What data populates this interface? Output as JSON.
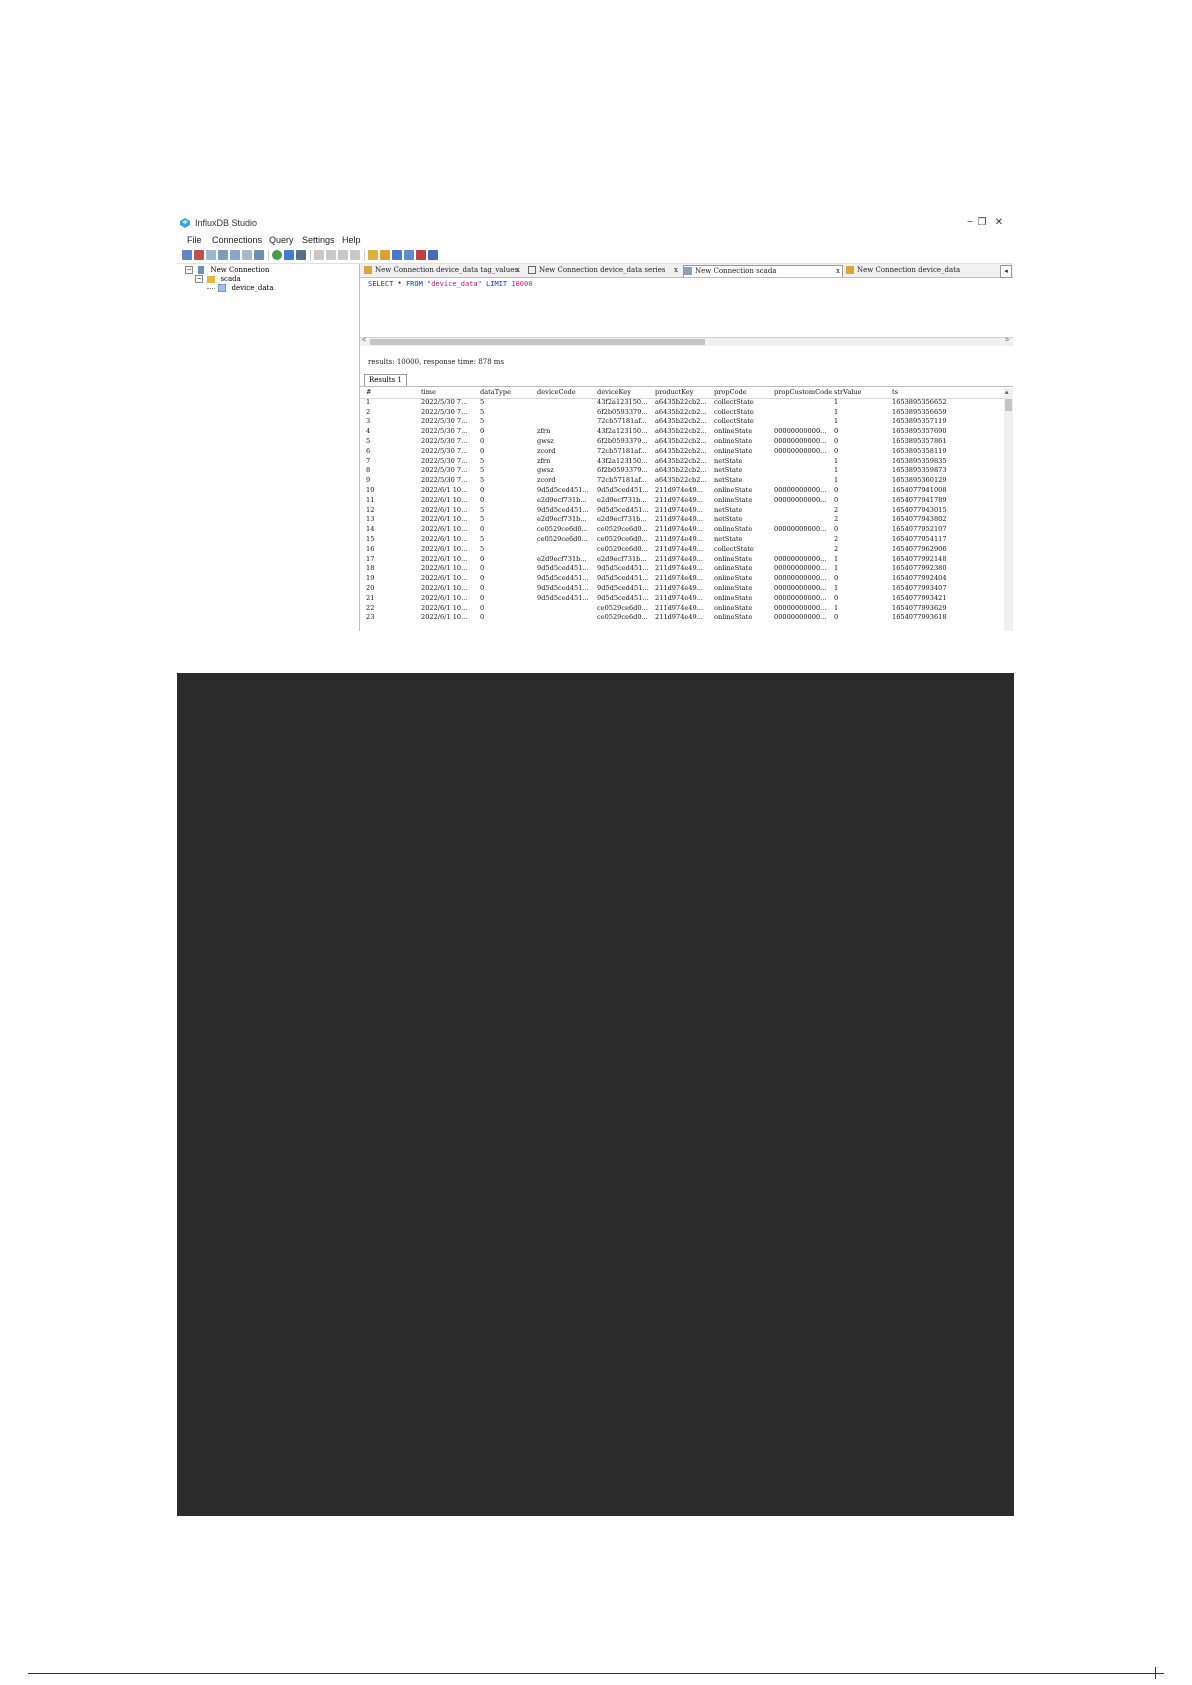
{
  "window": {
    "title": "InfluxDB Studio",
    "controls": {
      "minimize": "−",
      "restore": "❐",
      "close": "✕"
    }
  },
  "menu": [
    "File",
    "Connections",
    "Query",
    "Settings",
    "Help"
  ],
  "toolbar_icons": [
    "new-connection-icon",
    "delete-icon",
    "edit-icon",
    "database-icon",
    "chart-icon",
    "table-icon",
    "refresh-icon",
    "run-icon",
    "query-icon",
    "copy-icon",
    "paste-icon",
    "cut-icon",
    "undo-icon",
    "user-icon",
    "users-icon",
    "grid-icon",
    "list-icon",
    "export-icon",
    "settings-icon"
  ],
  "tree": {
    "connection": "New Connection",
    "database": "scada",
    "measurement": "device_data"
  },
  "tabs": [
    {
      "label": "New Connection device_data tag_values",
      "close": "x",
      "active": false
    },
    {
      "label": "New Connection device_data series",
      "close": "x",
      "active": false
    },
    {
      "label": "New Connection scada",
      "close": "x",
      "active": true
    },
    {
      "label": "New Connection device_data",
      "close": "",
      "active": false
    }
  ],
  "tab_scroll_arrow": "◂",
  "query": {
    "select": "SELECT",
    "star": " * ",
    "from": "FROM",
    "measurement": "\"device_data\"",
    "limit": "LIMIT",
    "limit_value": "10000"
  },
  "hscroll": {
    "left": "<",
    "right": ">"
  },
  "status": "results: 10000, response time: 878 ms",
  "result_tab": "Results 1",
  "grid": {
    "columns": [
      "#",
      "time",
      "dataType",
      "deviceCode",
      "deviceKey",
      "productKey",
      "propCode",
      "propCustomCode",
      "strValue",
      "ts"
    ],
    "rows": [
      [
        "1",
        "2022/5/30 7...",
        "5",
        "",
        "43f2a123150...",
        "a6435b22cb2...",
        "collectState",
        "",
        "1",
        "1653895356652"
      ],
      [
        "2",
        "2022/5/30 7...",
        "5",
        "",
        "6f2b0593379...",
        "a6435b22cb2...",
        "collectState",
        "",
        "1",
        "1653895356659"
      ],
      [
        "3",
        "2022/5/30 7...",
        "5",
        "",
        "72cb57181af...",
        "a6435b22cb2...",
        "collectState",
        "",
        "1",
        "1653895357119"
      ],
      [
        "4",
        "2022/5/30 7...",
        "0",
        "zfrn",
        "43f2a123150...",
        "a6435b22cb2...",
        "onlineState",
        "00000000000...",
        "0",
        "1653895357690"
      ],
      [
        "5",
        "2022/5/30 7...",
        "0",
        "gwsz",
        "6f2b0593379...",
        "a6435b22cb2...",
        "onlineState",
        "00000000000...",
        "0",
        "1653895357861"
      ],
      [
        "6",
        "2022/5/30 7...",
        "0",
        "zcord",
        "72cb57181af...",
        "a6435b22cb2...",
        "onlineState",
        "00000000000...",
        "0",
        "1653895358119"
      ],
      [
        "7",
        "2022/5/30 7...",
        "5",
        "zfrn",
        "43f2a123150...",
        "a6435b22cb2...",
        "netState",
        "",
        "1",
        "1653895359835"
      ],
      [
        "8",
        "2022/5/30 7...",
        "5",
        "gwsz",
        "6f2b0593379...",
        "a6435b22cb2...",
        "netState",
        "",
        "1",
        "1653895359873"
      ],
      [
        "9",
        "2022/5/30 7...",
        "5",
        "zcord",
        "72cb57181af...",
        "a6435b22cb2...",
        "netState",
        "",
        "1",
        "1653895360129"
      ],
      [
        "10",
        "2022/6/1 10...",
        "0",
        "9d5d5ced451...",
        "9d5d5ced451...",
        "211d974e49...",
        "onlineState",
        "00000000000...",
        "0",
        "1654077941008"
      ],
      [
        "11",
        "2022/6/1 10...",
        "0",
        "e2d9ecf731b...",
        "e2d9ecf731b...",
        "211d974e49...",
        "onlineState",
        "00000000000...",
        "0",
        "1654077941789"
      ],
      [
        "12",
        "2022/6/1 10...",
        "5",
        "9d5d5ced451...",
        "9d5d5ced451...",
        "211d974e49...",
        "netState",
        "",
        "2",
        "1654077943015"
      ],
      [
        "13",
        "2022/6/1 10...",
        "5",
        "e2d9ecf731b...",
        "e2d9ecf731b...",
        "211d974e49...",
        "netState",
        "",
        "2",
        "1654077943802"
      ],
      [
        "14",
        "2022/6/1 10...",
        "0",
        "ce0529ce6d0...",
        "ce0529ce6d0...",
        "211d974e49...",
        "onlineState",
        "00000000000...",
        "0",
        "1654077952107"
      ],
      [
        "15",
        "2022/6/1 10...",
        "5",
        "ce0529ce6d0...",
        "ce0529ce6d0...",
        "211d974e49...",
        "netState",
        "",
        "2",
        "1654077954117"
      ],
      [
        "16",
        "2022/6/1 10...",
        "5",
        "",
        "ce0529ce6d0...",
        "211d974e49...",
        "collectState",
        "",
        "2",
        "1654077962906"
      ],
      [
        "17",
        "2022/6/1 10...",
        "0",
        "e2d9ecf731b...",
        "e2d9ecf731b...",
        "211d974e49...",
        "onlineState",
        "00000000000...",
        "1",
        "1654077992148"
      ],
      [
        "18",
        "2022/6/1 10...",
        "0",
        "9d5d5ced451...",
        "9d5d5ced451...",
        "211d974e49...",
        "onlineState",
        "00000000000...",
        "1",
        "1654077992380"
      ],
      [
        "19",
        "2022/6/1 10...",
        "0",
        "9d5d5ced451...",
        "9d5d5ced451...",
        "211d974e49...",
        "onlineState",
        "00000000000...",
        "0",
        "1654077992404"
      ],
      [
        "20",
        "2022/6/1 10...",
        "0",
        "9d5d5ced451...",
        "9d5d5ced451...",
        "211d974e49...",
        "onlineState",
        "00000000000...",
        "1",
        "1654077993407"
      ],
      [
        "21",
        "2022/6/1 10...",
        "0",
        "9d5d5ced451...",
        "9d5d5ced451...",
        "211d974e49...",
        "onlineState",
        "00000000000...",
        "0",
        "1654077993421"
      ],
      [
        "22",
        "2022/6/1 10...",
        "0",
        "",
        "ce0529ce6d0...",
        "211d974e49...",
        "onlineState",
        "00000000000...",
        "1",
        "1654077993629"
      ],
      [
        "23",
        "2022/6/1 10...",
        "0",
        "",
        "ce0529ce6d0...",
        "211d974e49...",
        "onlineState",
        "00000000000...",
        "0",
        "1654077993618"
      ]
    ]
  },
  "colors": {
    "keyword": "#1a2fd6",
    "string": "#c2187a",
    "dark_panel": "#2b2b2b"
  }
}
